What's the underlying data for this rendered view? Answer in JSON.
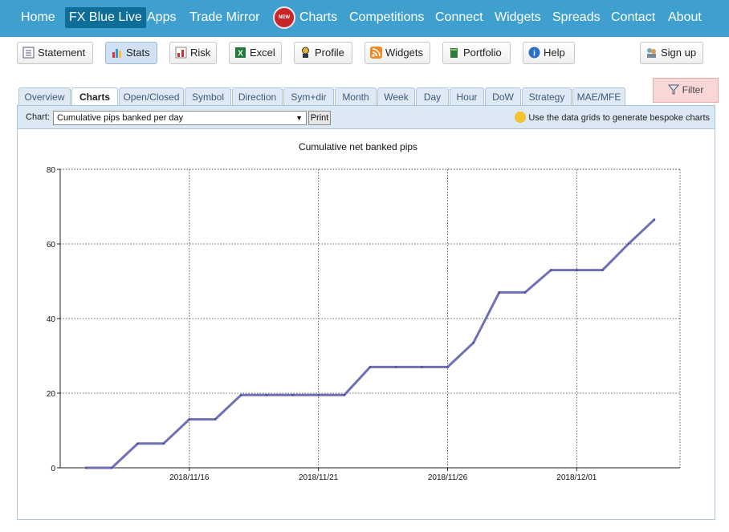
{
  "nav": {
    "items": [
      {
        "label": "Home"
      },
      {
        "label": "FX Blue Live"
      },
      {
        "label": "Apps"
      },
      {
        "label": "Trade Mirror"
      },
      {
        "label": "Charts"
      },
      {
        "label": "Competitions"
      },
      {
        "label": "Connect"
      },
      {
        "label": "Widgets"
      },
      {
        "label": "Spreads"
      },
      {
        "label": "Contact"
      },
      {
        "label": "About"
      }
    ],
    "new_badge": "NEW",
    "active": "FX Blue Live",
    "colors": {
      "bar": "#3fa0cf",
      "active": "#0f6e98"
    }
  },
  "toolbar": {
    "buttons": [
      {
        "label": "Statement",
        "icon": "statement-icon"
      },
      {
        "label": "Stats",
        "icon": "stats-icon"
      },
      {
        "label": "Risk",
        "icon": "risk-icon"
      },
      {
        "label": "Excel",
        "icon": "excel-icon"
      },
      {
        "label": "Profile",
        "icon": "profile-icon"
      },
      {
        "label": "Widgets",
        "icon": "rss-icon"
      },
      {
        "label": "Portfolio",
        "icon": "portfolio-icon"
      },
      {
        "label": "Help",
        "icon": "help-icon"
      },
      {
        "label": "Sign up",
        "icon": "signup-icon"
      }
    ],
    "selected": "Stats"
  },
  "tabs": {
    "items": [
      "Overview",
      "Charts",
      "Open/Closed",
      "Symbol",
      "Direction",
      "Sym+dir",
      "Month",
      "Week",
      "Day",
      "Hour",
      "DoW",
      "Strategy",
      "MAE/MFE"
    ],
    "active": "Charts"
  },
  "filter": {
    "label": "Filter",
    "icon": "filter-icon"
  },
  "chart_controls": {
    "label": "Chart:",
    "selected": "Cumulative pips banked per day",
    "print_label": "Print",
    "hint": "Use the data grids to generate bespoke charts"
  },
  "chart_data": {
    "type": "line",
    "title": "Cumulative net banked pips",
    "xlabel": "",
    "ylabel": "",
    "ylim": [
      0,
      80
    ],
    "yticks": [
      0,
      20,
      40,
      60,
      80
    ],
    "xticks": [
      "2018/11/16",
      "2018/11/21",
      "2018/11/26",
      "2018/12/01"
    ],
    "grid": true,
    "line_color": "#6f70b6",
    "series": [
      {
        "points": [
          [
            "2018/11/12",
            0
          ],
          [
            "2018/11/13",
            0
          ],
          [
            "2018/11/14",
            6.5
          ],
          [
            "2018/11/15",
            6.5
          ],
          [
            "2018/11/16",
            13
          ],
          [
            "2018/11/17",
            13
          ],
          [
            "2018/11/18",
            19.5
          ],
          [
            "2018/11/19",
            19.5
          ],
          [
            "2018/11/20",
            19.5
          ],
          [
            "2018/11/21",
            19.5
          ],
          [
            "2018/11/22",
            19.5
          ],
          [
            "2018/11/23",
            27
          ],
          [
            "2018/11/24",
            27
          ],
          [
            "2018/11/25",
            27
          ],
          [
            "2018/11/26",
            27
          ],
          [
            "2018/11/27",
            33.5
          ],
          [
            "2018/11/28",
            47
          ],
          [
            "2018/11/29",
            47
          ],
          [
            "2018/11/30",
            53
          ],
          [
            "2018/12/01",
            53
          ],
          [
            "2018/12/02",
            53
          ],
          [
            "2018/12/03",
            60
          ],
          [
            "2018/12/04",
            66.5
          ]
        ]
      }
    ]
  }
}
